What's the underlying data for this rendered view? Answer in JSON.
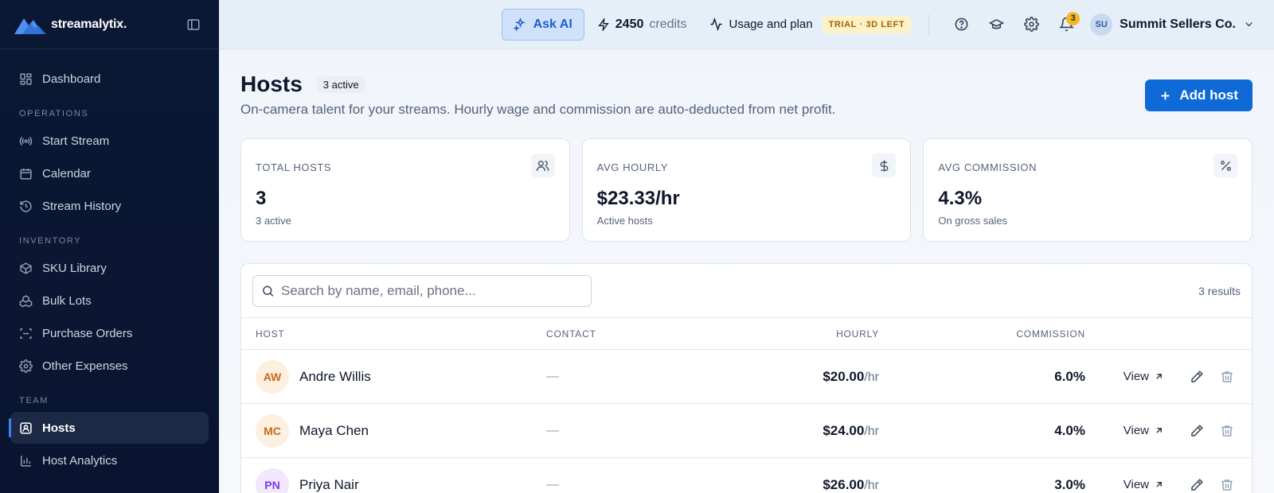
{
  "brand": {
    "name": "streamalytix."
  },
  "sidebar": {
    "top_items": [
      {
        "label": "Dashboard"
      }
    ],
    "sections": [
      {
        "title": "OPERATIONS",
        "items": [
          {
            "label": "Start Stream"
          },
          {
            "label": "Calendar"
          },
          {
            "label": "Stream History"
          }
        ]
      },
      {
        "title": "INVENTORY",
        "items": [
          {
            "label": "SKU Library"
          },
          {
            "label": "Bulk Lots"
          },
          {
            "label": "Purchase Orders"
          },
          {
            "label": "Other Expenses"
          }
        ]
      },
      {
        "title": "TEAM",
        "items": [
          {
            "label": "Hosts",
            "active": true
          },
          {
            "label": "Host Analytics"
          }
        ]
      }
    ]
  },
  "topbar": {
    "ask_ai": "Ask AI",
    "credits_value": "2450",
    "credits_label": "credits",
    "usage_label": "Usage and plan",
    "trial_badge": "TRIAL · 3D LEFT",
    "notifications_count": "3",
    "user_initials": "SU",
    "user_name": "Summit Sellers Co."
  },
  "page": {
    "title": "Hosts",
    "active_pill": "3 active",
    "subtitle": "On-camera talent for your streams. Hourly wage and commission are auto-deducted from net profit.",
    "add_button": "Add host"
  },
  "stats": [
    {
      "label": "TOTAL HOSTS",
      "value": "3",
      "sub": "3 active",
      "icon": "users-icon"
    },
    {
      "label": "AVG HOURLY",
      "value": "$23.33/hr",
      "sub": "Active hosts",
      "icon": "dollar-icon"
    },
    {
      "label": "AVG COMMISSION",
      "value": "4.3%",
      "sub": "On gross sales",
      "icon": "percent-icon"
    }
  ],
  "table": {
    "search_placeholder": "Search by name, email, phone...",
    "results": "3 results",
    "columns": {
      "host": "HOST",
      "contact": "CONTACT",
      "hourly": "HOURLY",
      "commission": "COMMISSION"
    },
    "view_label": "View",
    "rows": [
      {
        "initials": "AW",
        "name": "Andre Willis",
        "contact": "—",
        "hourly": "$20.00",
        "unit": "/hr",
        "commission": "6.0%",
        "avatar_bg": "#fdf0e0",
        "avatar_fg": "#c46a1c"
      },
      {
        "initials": "MC",
        "name": "Maya Chen",
        "contact": "—",
        "hourly": "$24.00",
        "unit": "/hr",
        "commission": "4.0%",
        "avatar_bg": "#fdf0e0",
        "avatar_fg": "#c46a1c"
      },
      {
        "initials": "PN",
        "name": "Priya Nair",
        "contact": "—",
        "hourly": "$26.00",
        "unit": "/hr",
        "commission": "3.0%",
        "avatar_bg": "#f1e8fd",
        "avatar_fg": "#7c3aed"
      }
    ]
  },
  "colors": {
    "accent": "#0f6ad8",
    "sidebar_bg": "#0b1835",
    "trial_bg": "#fdf2c7",
    "trial_fg": "#a16207"
  }
}
